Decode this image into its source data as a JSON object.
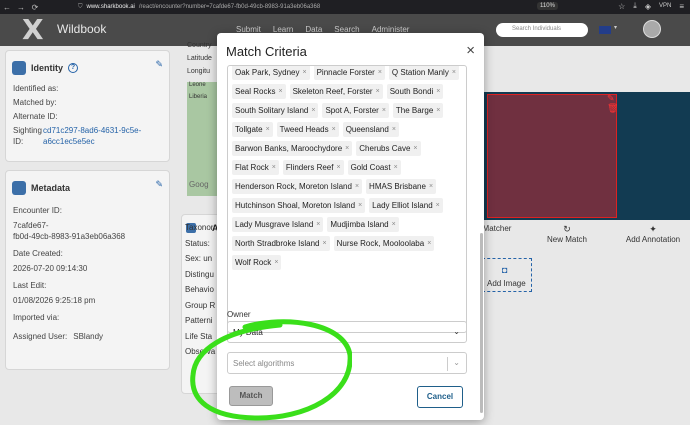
{
  "browser": {
    "url_host": "www.sharkbook.ai",
    "url_path": "/react/encounter?number=7cafde67-fb0d-49cb-8983-91a3eb06a368",
    "zoom": "110%",
    "vpn": "VPN"
  },
  "header": {
    "logo": "X",
    "app_name": "Wildbook",
    "nav": [
      "Submit",
      "Learn",
      "Data",
      "Search",
      "Administer"
    ],
    "search_placeholder": "Search Individuals"
  },
  "identity_card": {
    "title": "Identity",
    "fields": {
      "identified_as": "Identified as:",
      "matched_by": "Matched by:",
      "alternate_id": "Alternate ID:",
      "sighting_id_label": "Sighting ID:",
      "sighting_id_value_1": "cd71c297-8ad6-4631-9c5e-",
      "sighting_id_value_2": "a6cc1ec5e5ec"
    }
  },
  "metadata_card": {
    "title": "Metadata",
    "encounter_id_label": "Encounter ID:",
    "encounter_id_1": "7cafde67-",
    "encounter_id_2": "fb0d-49cb-8983-91a3eb06a368",
    "date_created_label": "Date Created:",
    "date_created": "2026-07-20 09:14:30",
    "last_edit_label": "Last Edit:",
    "last_edit": "01/08/2026 9:25:18 pm",
    "imported_via_label": "Imported via:",
    "assigned_user_label": "Assigned User:",
    "assigned_user": "SBlandy"
  },
  "location_partial": {
    "labels": [
      "Country",
      "Latitude",
      "Longitu"
    ],
    "map_text": [
      "Leone",
      "Liberia",
      "Goog"
    ]
  },
  "attributes_partial": {
    "labels": [
      "Taxonor",
      "Status:",
      "Sex: un",
      "Distingu",
      "Behavio",
      "Group R",
      "Patterni",
      "Life Sta",
      "Observa"
    ]
  },
  "image_panel": {
    "actions": [
      "Matcher",
      "New Match",
      "Add Annotation"
    ],
    "add_image": "Add Image"
  },
  "modal": {
    "title": "Match Criteria",
    "close": "×",
    "tags": [
      "Oak Park, Sydney",
      "Pinnacle Forster",
      "Q Station Manly",
      "Seal Rocks",
      "Skeleton Reef, Forster",
      "South Bondi",
      "South Solitary Island",
      "Spot A, Forster",
      "The Barge",
      "Tollgate",
      "Tweed Heads",
      "Queensland",
      "Barwon Banks, Maroochydore",
      "Cherubs Cave",
      "Flat Rock",
      "Flinders Reef",
      "Gold Coast",
      "Henderson Rock, Moreton Island",
      "HMAS Brisbane",
      "Hutchinson Shoal, Moreton Island",
      "Lady Elliot Island",
      "Lady Musgrave Island",
      "Mudjimba Island",
      "North Stradbroke Island",
      "Nurse Rock, Mooloolaba",
      "Wolf Rock"
    ],
    "owner_label": "Owner",
    "owner_value": "My Data",
    "algorithms_placeholder": "Select algorithms",
    "match_button": "Match",
    "cancel_button": "Cancel"
  },
  "colors": {
    "header_bg": "#4a4a4a",
    "link": "#2563a8",
    "cancel_border": "#1f5f8a",
    "annotation_loop": "#3adf1a"
  }
}
